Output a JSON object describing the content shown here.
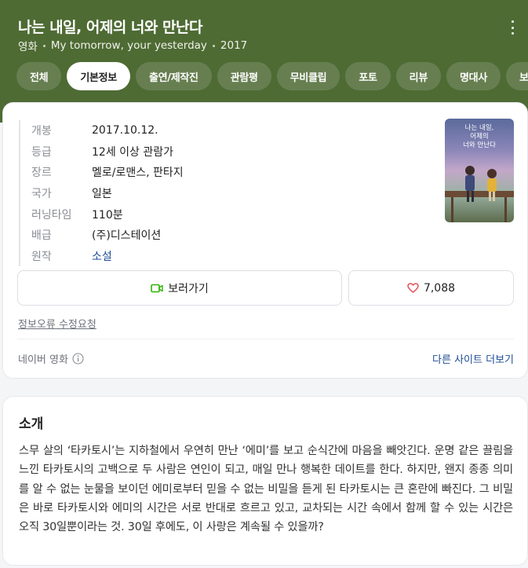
{
  "header": {
    "title": "나는 내일, 어제의 너와 만난다",
    "subtitle": [
      "영화",
      "My tomorrow, your yesterday",
      "2017"
    ],
    "bg_color": "#4e6b34"
  },
  "tabs": [
    {
      "label": "전체",
      "active": false
    },
    {
      "label": "기본정보",
      "active": true
    },
    {
      "label": "출연/제작진",
      "active": false
    },
    {
      "label": "관람평",
      "active": false
    },
    {
      "label": "무비클립",
      "active": false
    },
    {
      "label": "포토",
      "active": false
    },
    {
      "label": "리뷰",
      "active": false
    },
    {
      "label": "명대사",
      "active": false
    },
    {
      "label": "보",
      "active": false
    }
  ],
  "info": [
    {
      "key": "개봉",
      "value": "2017.10.12."
    },
    {
      "key": "등급",
      "value": "12세 이상 관람가"
    },
    {
      "key": "장르",
      "value": "멜로/로맨스, 판타지"
    },
    {
      "key": "국가",
      "value": "일본"
    },
    {
      "key": "러닝타임",
      "value": "110분"
    },
    {
      "key": "배급",
      "value": "(주)디스테이션"
    },
    {
      "key": "원작",
      "value": "소설"
    }
  ],
  "poster": {
    "title_text": "나는 내일, 어제의 너와 만난다"
  },
  "actions": {
    "watch_label": "보러가기",
    "like_count": "7,088"
  },
  "report_label": "정보오류 수정요청",
  "source": {
    "label": "네이버 영화",
    "more_label": "다른 사이트 더보기"
  },
  "intro": {
    "title": "소개",
    "text": "스무 살의 ‘타카토시’는 지하철에서 우연히 만난 ‘에미’를 보고 순식간에 마음을 빼앗긴다. 운명 같은 끌림을 느낀 타카토시의 고백으로 두 사람은 연인이 되고, 매일 만나 행복한 데이트를 한다. 하지만, 왠지 종종 의미를 알 수 없는 눈물을 보이던 에미로부터 믿을 수 없는 비밀을 듣게 된 타카토시는 큰 혼란에 빠진다. 그 비밀은 바로 타카토시와 에미의 시간은 서로 반대로 흐르고 있고, 교차되는 시간 속에서 함께 할 수 있는 시간은 오직 30일뿐이라는 것. 30일 후에도, 이 사랑은 계속될 수 있을까?"
  },
  "colors": {
    "link": "#1e4c93",
    "heart": "#e0505b",
    "video_icon": "#2db400"
  }
}
